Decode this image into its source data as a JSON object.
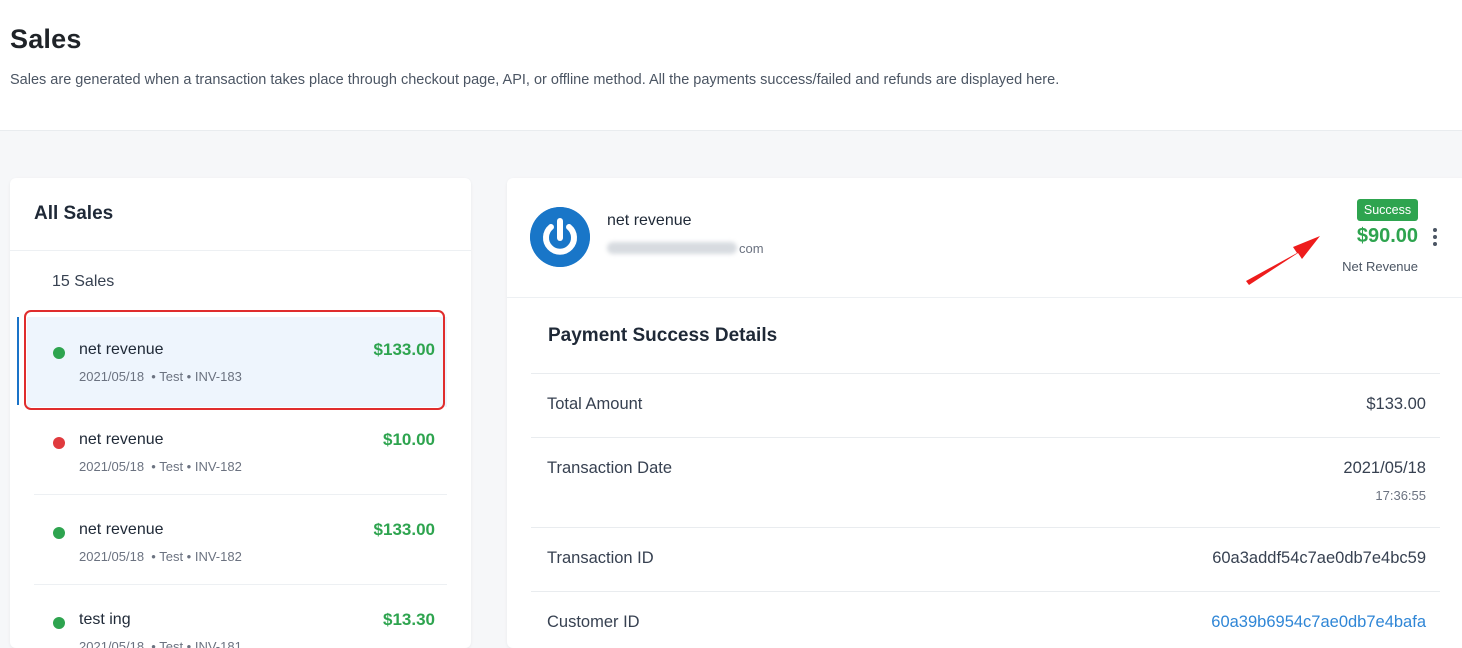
{
  "page": {
    "title": "Sales",
    "description": "Sales are generated when a transaction takes place through checkout page, API, or offline method. All the payments success/failed and refunds are displayed here."
  },
  "sales_list": {
    "title": "All Sales",
    "count_label": "15 Sales",
    "items": [
      {
        "name": "net revenue",
        "meta": "2021/05/18  • Test • INV-183",
        "amount": "$133.00",
        "status_color": "#2ea44f"
      },
      {
        "name": "net revenue",
        "meta": "2021/05/18  • Test • INV-182",
        "amount": "$10.00",
        "status_color": "#e03a3e"
      },
      {
        "name": "net revenue",
        "meta": "2021/05/18  • Test • INV-182",
        "amount": "$133.00",
        "status_color": "#2ea44f"
      },
      {
        "name": "test ing",
        "meta": "2021/05/18  • Test • INV-181",
        "amount": "$13.30",
        "status_color": "#2ea44f"
      }
    ]
  },
  "detail": {
    "customer_name": "net revenue",
    "email_suffix": "com",
    "status_badge": "Success",
    "net_amount": "$90.00",
    "net_label": "Net Revenue",
    "section_title": "Payment Success Details",
    "rows": [
      {
        "label": "Total Amount",
        "value": "$133.00"
      },
      {
        "label": "Transaction Date",
        "value": "2021/05/18",
        "sub": "17:36:55"
      },
      {
        "label": "Transaction ID",
        "value": "60a3addf54c7ae0db7e4bc59"
      },
      {
        "label": "Customer ID",
        "value": "60a39b6954c7ae0db7e4bafa"
      }
    ]
  },
  "colors": {
    "success": "#2ea44f",
    "failed": "#e03a3e",
    "accent": "#1a73c8",
    "highlight": "#e02d2d",
    "link": "#2f86d6"
  },
  "icons": {
    "avatar": "power-icon",
    "menu": "kebab-menu-icon",
    "annotation": "red-arrow-icon"
  }
}
